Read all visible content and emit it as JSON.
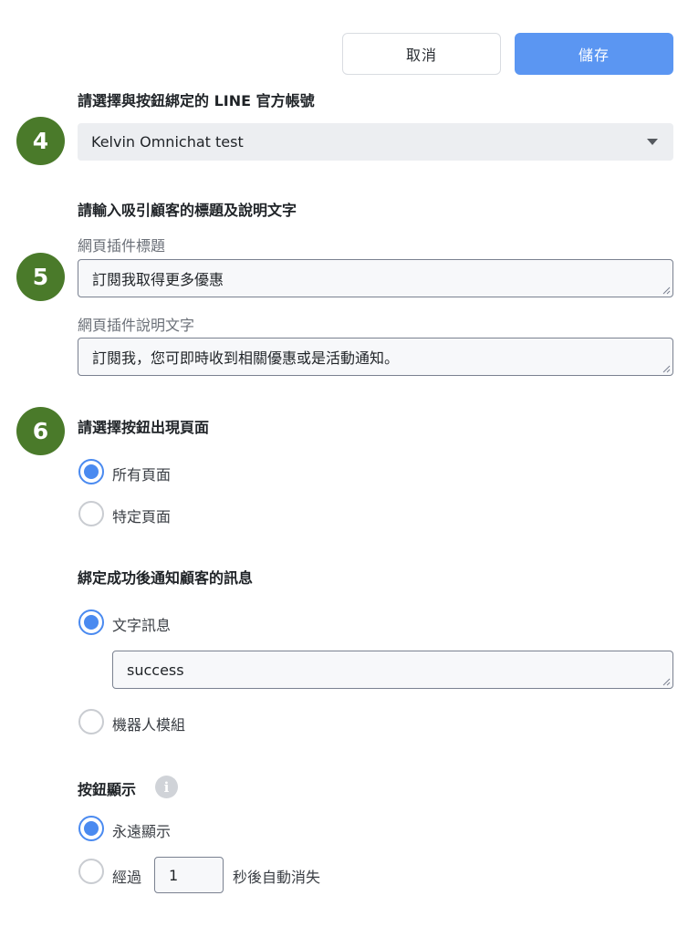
{
  "header": {
    "cancel_label": "取消",
    "save_label": "儲存"
  },
  "steps": {
    "s4": "4",
    "s5": "5",
    "s6": "6"
  },
  "account": {
    "heading": "請選擇與按鈕綁定的 LINE 官方帳號",
    "selected": "Kelvin Omnichat test"
  },
  "texts": {
    "heading": "請輸入吸引顧客的標題及說明文字",
    "title_label": "網頁插件標題",
    "title_value": "訂閱我取得更多優惠",
    "desc_label": "網頁插件說明文字",
    "desc_value": "訂閱我，您可即時收到相關優惠或是活動通知。"
  },
  "pages": {
    "heading": "請選擇按鈕出現頁面",
    "options": [
      {
        "label": "所有頁面",
        "checked": true
      },
      {
        "label": "特定頁面",
        "checked": false
      }
    ]
  },
  "notify": {
    "heading": "綁定成功後通知顧客的訊息",
    "options": [
      {
        "label": "文字訊息",
        "checked": true
      },
      {
        "label": "機器人模組",
        "checked": false
      }
    ],
    "message_value": "success"
  },
  "display": {
    "heading": "按鈕顯示",
    "info_glyph": "i",
    "always_label": "永遠顯示",
    "after_prefix": "經過",
    "seconds_value": "1",
    "after_suffix": "秒後自動消失",
    "always_checked": true
  },
  "colors": {
    "primary": "#5b96f2",
    "step_badge": "#4a7a2a",
    "radio_on": "#4a8af0"
  },
  "icons": {
    "select_arrow": "caret-down-icon",
    "info": "info-icon",
    "resize": "resize-grip-icon"
  }
}
